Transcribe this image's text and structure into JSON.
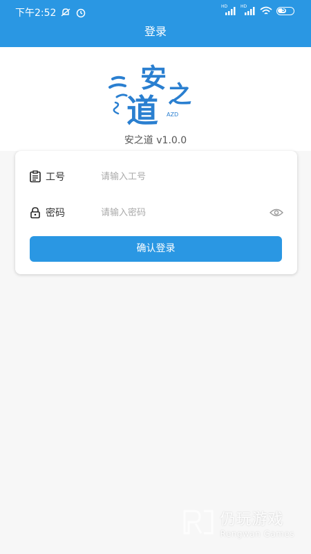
{
  "status_bar": {
    "time": "下午2:52",
    "network_labels": [
      "HD",
      "HD"
    ],
    "battery": "57",
    "icons": [
      "mute-icon",
      "alarm-icon",
      "signal-icon",
      "signal-icon",
      "wifi-icon",
      "battery-icon"
    ]
  },
  "app_bar": {
    "title": "登录"
  },
  "logo": {
    "chars": [
      "安",
      "道",
      "之"
    ],
    "small_text": "AZD"
  },
  "version": "安之道 v1.0.0",
  "form": {
    "employee_label": "工号",
    "employee_placeholder": "请输入工号",
    "employee_value": "",
    "password_label": "密码",
    "password_placeholder": "请输入密码",
    "password_value": "",
    "submit_label": "确认登录"
  },
  "watermark": {
    "main": "仍玩游戏",
    "sub": "Rengwan Games"
  },
  "colors": {
    "primary": "#2a97e3",
    "background": "#f7f7f7",
    "card": "#ffffff"
  }
}
